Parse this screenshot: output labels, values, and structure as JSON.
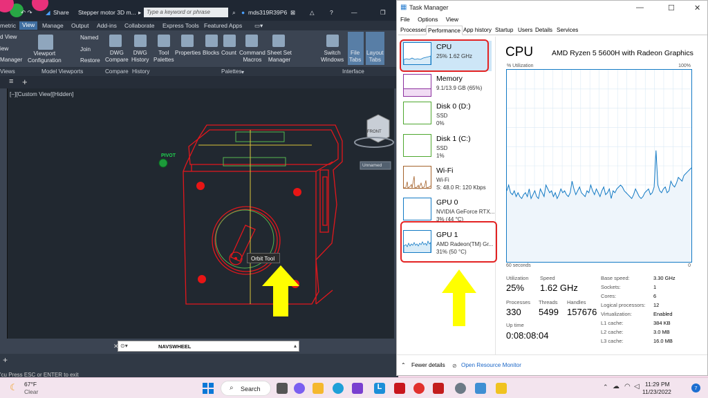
{
  "autocad": {
    "title": "Stepper motor 3D m...",
    "share_label": "Share",
    "search_placeholder": "Type a keyword or phrase",
    "user": "mds319R39P6",
    "ribbon_tabs": [
      "metric",
      "View",
      "Manage",
      "Output",
      "Add-ins",
      "Collaborate",
      "Express Tools",
      "Featured Apps"
    ],
    "active_tab": "View",
    "ribbon_items": {
      "views_top": "d View",
      "views_mid": "iew",
      "views_bot": "Manager",
      "viewport_config": "Viewport\nConfiguration",
      "named": "Named",
      "join": "Join",
      "restore": "Restore",
      "dwg_compare": "DWG\nCompare",
      "dwg_history": "DWG\nHistory",
      "tool_palettes": "Tool\nPalettes",
      "properties": "Properties",
      "blocks": "Blocks",
      "count": "Count",
      "command_macros": "Command\nMacros",
      "sheet_set_manager": "Sheet Set\nManager",
      "switch_windows": "Switch\nWindows",
      "file_tabs": "File\nTabs",
      "layout_tabs": "Layout\nTabs"
    },
    "panels": [
      "Views",
      "Model Viewports",
      "Compare",
      "History",
      "Palettes",
      "Interface"
    ],
    "view_label": "[−][Custom View][Hidden]",
    "pivot_label": "PIVOT",
    "cube_label": "FRONT",
    "unnamed_label": "Unnamed",
    "orbit_tooltip": "Orbit Tool",
    "navswheel": "NAVSWHEEL",
    "command_text": "'cu Press ESC or ENTER to exit"
  },
  "taskmanager": {
    "title": "Task Manager",
    "menu": [
      "File",
      "Options",
      "View"
    ],
    "tabs": [
      "Processes",
      "Performance",
      "App history",
      "Startup",
      "Users",
      "Details",
      "Services"
    ],
    "active_tab": "Performance",
    "resources": [
      {
        "name": "CPU",
        "d1": "25% 1.62 GHz",
        "d2": "",
        "color": "#1179c4"
      },
      {
        "name": "Memory",
        "d1": "9.1/13.9 GB (65%)",
        "d2": "",
        "color": "#8b2f9e"
      },
      {
        "name": "Disk 0 (D:)",
        "d1": "SSD",
        "d2": "0%",
        "color": "#4ea72e"
      },
      {
        "name": "Disk 1 (C:)",
        "d1": "SSD",
        "d2": "1%",
        "color": "#4ea72e"
      },
      {
        "name": "Wi-Fi",
        "d1": "Wi-Fi",
        "d2": "S: 48.0  R: 120 Kbps",
        "color": "#a4622b"
      },
      {
        "name": "GPU 0",
        "d1": "NVIDIA GeForce RTX...",
        "d2": "3% (44 °C)",
        "color": "#1179c4"
      },
      {
        "name": "GPU 1",
        "d1": "AMD Radeon(TM) Gr...",
        "d2": "31% (50 °C)",
        "color": "#1179c4"
      }
    ],
    "cpu_header": "CPU",
    "cpu_model": "AMD Ryzen 5 5600H with Radeon Graphics",
    "util_label": "% Utilization",
    "util_max": "100%",
    "graph_left": "60 seconds",
    "graph_right": "0",
    "stats": {
      "utilization_label": "Utilization",
      "utilization": "25%",
      "speed_label": "Speed",
      "speed": "1.62 GHz",
      "processes_label": "Processes",
      "processes": "330",
      "threads_label": "Threads",
      "threads": "5499",
      "handles_label": "Handles",
      "handles": "157676",
      "uptime_label": "Up time",
      "uptime": "0:08:08:04"
    },
    "kv": [
      {
        "k": "Base speed:",
        "v": "3.30 GHz"
      },
      {
        "k": "Sockets:",
        "v": "1"
      },
      {
        "k": "Cores:",
        "v": "6"
      },
      {
        "k": "Logical processors:",
        "v": "12"
      },
      {
        "k": "Virtualization:",
        "v": "Enabled"
      },
      {
        "k": "L1 cache:",
        "v": "384 KB"
      },
      {
        "k": "L2 cache:",
        "v": "3.0 MB"
      },
      {
        "k": "L3 cache:",
        "v": "16.0 MB"
      }
    ],
    "fewer_details": "Fewer details",
    "open_monitor": "Open Resource Monitor",
    "graph_series": [
      37,
      40,
      36,
      35,
      37,
      34,
      36,
      34,
      33,
      35,
      36,
      34,
      38,
      33,
      35,
      37,
      34,
      33,
      38,
      36,
      34,
      40,
      38,
      36,
      37,
      34,
      36,
      33,
      35,
      38,
      36,
      37,
      35,
      34,
      36,
      42,
      38,
      35,
      37,
      39,
      36,
      35,
      34,
      37,
      36,
      40,
      37,
      35,
      38,
      36,
      34,
      37,
      39,
      35,
      36,
      38,
      33,
      37,
      36,
      38,
      39,
      40,
      39,
      37,
      36,
      35,
      34,
      33,
      35,
      38,
      36,
      34,
      33,
      34,
      36,
      37,
      38,
      35,
      36,
      39,
      58,
      40,
      37,
      36,
      38,
      39,
      36,
      37,
      42,
      40,
      39,
      41,
      44,
      43,
      42,
      45,
      46,
      47,
      48,
      49
    ]
  },
  "taskbar": {
    "weather_temp": "67°F",
    "weather_desc": "Clear",
    "search_label": "Search",
    "time": "11:29 PM",
    "date": "11/23/2022",
    "notif_count": "7"
  }
}
